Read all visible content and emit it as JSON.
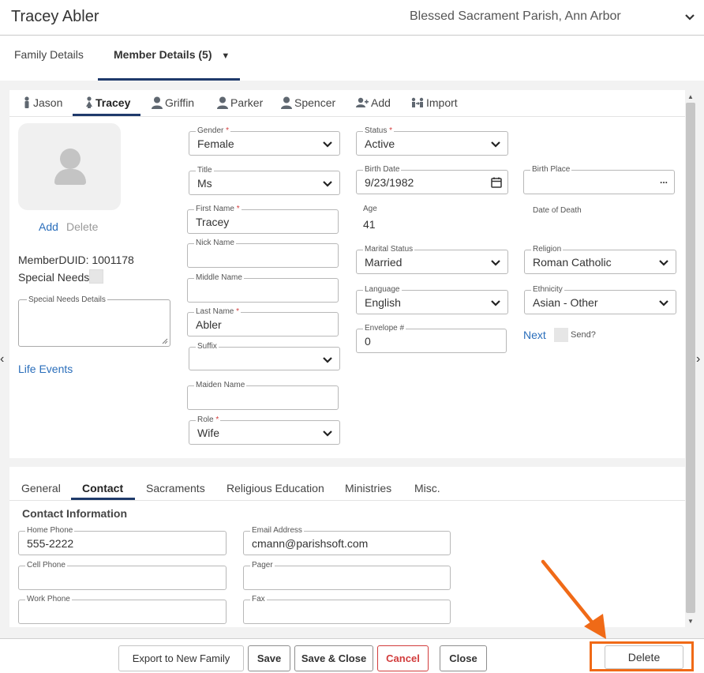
{
  "header": {
    "member_name": "Tracey Abler",
    "parish": "Blessed Sacrament Parish, Ann Arbor"
  },
  "top_tabs": [
    {
      "label": "Family Details"
    },
    {
      "label": "Member Details (5)",
      "caret": "▼"
    }
  ],
  "member_tabs": [
    {
      "label": "Jason",
      "icon": "male-icon"
    },
    {
      "label": "Tracey",
      "icon": "female-icon"
    },
    {
      "label": "Griffin",
      "icon": "person-icon"
    },
    {
      "label": "Parker",
      "icon": "person-icon"
    },
    {
      "label": "Spencer",
      "icon": "person-icon"
    },
    {
      "label": "Add",
      "icon": "add-person-icon"
    },
    {
      "label": "Import",
      "icon": "import-icon"
    }
  ],
  "photo": {
    "add": "Add",
    "delete": "Delete"
  },
  "member_info": {
    "duid": "MemberDUID: 1001178",
    "special_needs": "Special Needs",
    "special_needs_details": "Special Needs Details",
    "life_events": "Life Events"
  },
  "fields": {
    "gender": {
      "label": "Gender",
      "value": "Female"
    },
    "title": {
      "label": "Title",
      "value": "Ms"
    },
    "first_name": {
      "label": "First Name",
      "value": "Tracey"
    },
    "nick_name": {
      "label": "Nick Name",
      "value": ""
    },
    "middle_name": {
      "label": "Middle Name",
      "value": ""
    },
    "last_name": {
      "label": "Last Name",
      "value": "Abler"
    },
    "suffix": {
      "label": "Suffix",
      "value": ""
    },
    "maiden_name": {
      "label": "Maiden Name",
      "value": ""
    },
    "role": {
      "label": "Role",
      "value": "Wife"
    },
    "status": {
      "label": "Status",
      "value": "Active"
    },
    "birth_date": {
      "label": "Birth Date",
      "value": "9/23/1982"
    },
    "age": {
      "label": "Age",
      "value": "41"
    },
    "marital_status": {
      "label": "Marital Status",
      "value": "Married"
    },
    "language": {
      "label": "Language",
      "value": "English"
    },
    "envelope": {
      "label": "Envelope #",
      "value": "0"
    },
    "birth_place": {
      "label": "Birth Place",
      "value": "",
      "action": "..."
    },
    "date_of_death": {
      "label": "Date of Death"
    },
    "religion": {
      "label": "Religion",
      "value": "Roman Catholic"
    },
    "ethnicity": {
      "label": "Ethnicity",
      "value": "Asian - Other"
    },
    "next": "Next",
    "send": "Send?"
  },
  "sub_tabs": [
    "General",
    "Contact",
    "Sacraments",
    "Religious Education",
    "Ministries",
    "Misc."
  ],
  "contact": {
    "title": "Contact Information",
    "home_phone": {
      "label": "Home Phone",
      "value": "555-2222"
    },
    "cell_phone": {
      "label": "Cell Phone",
      "value": ""
    },
    "work_phone": {
      "label": "Work Phone",
      "value": ""
    },
    "email": {
      "label": "Email Address",
      "value": "cmann@parishsoft.com"
    },
    "pager": {
      "label": "Pager",
      "value": ""
    },
    "fax": {
      "label": "Fax",
      "value": ""
    }
  },
  "footer": {
    "export": "Export to New Family",
    "save": "Save",
    "save_close": "Save & Close",
    "cancel": "Cancel",
    "close": "Close",
    "delete": "Delete"
  },
  "nav": {
    "prev": "‹",
    "next": "›"
  },
  "required_mark": "*",
  "colors": {
    "accent": "#1f3a6b",
    "link": "#2a6ebb",
    "cancel": "#d23c3c",
    "highlight": "#f06a17"
  }
}
